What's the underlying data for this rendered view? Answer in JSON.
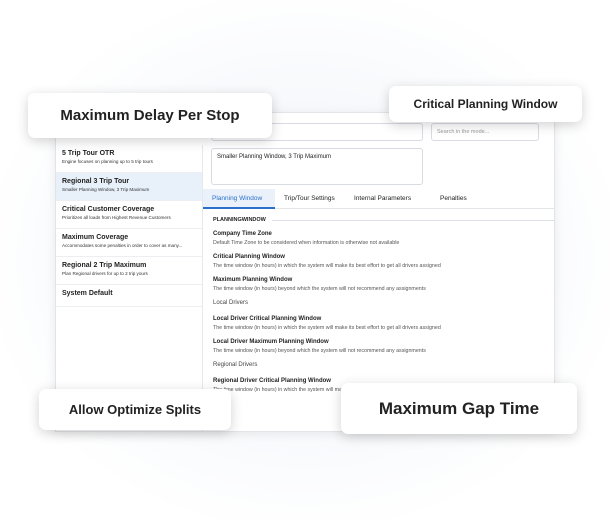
{
  "form": {
    "name_value": "Regional 3 Trip Tour",
    "search_placeholder": "Search in the mode...",
    "description_value": "Smaller Planning Window, 3 Trip Maximum"
  },
  "models": [
    {
      "title": "5 Trip Tour OTR",
      "subtitle": "Engine focuses on planning up to 5 trip tours"
    },
    {
      "title": "Regional 3 Trip Tour",
      "subtitle": "Smaller Planning Window, 3 Trip Maximum"
    },
    {
      "title": "Critical Customer Coverage",
      "subtitle": "Prioritizes all loads from Highest Revenue Customers"
    },
    {
      "title": "Maximum Coverage",
      "subtitle": "Accommodates some penalties in order to cover as many..."
    },
    {
      "title": "Regional 2 Trip Maximum",
      "subtitle": "Plan Regional drivers for up to 2 trip yours"
    },
    {
      "title": "System Default",
      "subtitle": ""
    }
  ],
  "tabs": [
    "Planning Window",
    "Trip/Tour Settings",
    "Internal Parameters",
    "Penalties"
  ],
  "content": {
    "section": "PLANNINGWINDOW",
    "fields": [
      {
        "title": "Company Time Zone",
        "desc": "Default Time Zone to be considered when information is otherwise not available"
      },
      {
        "title": "Critical Planning Window",
        "desc": "The time window (in hours) in which the system will make its best effort to get all drivers assigned"
      },
      {
        "title": "Maximum Planning Window",
        "desc": "The time window (in hours) beyond which the system will not recommend any assignments"
      }
    ],
    "group1": "Local Drivers",
    "local_fields": [
      {
        "title": "Local Driver Critical Planning Window",
        "desc": "The time window (in hours) in which the system will make its best effort to get all drivers assigned"
      },
      {
        "title": "Local Driver Maximum Planning Window",
        "desc": "The time window (in hours) beyond which the system will not recommend any assignments"
      }
    ],
    "group2": "Regional Drivers",
    "regional_fields": [
      {
        "title": "Regional Driver Critical Planning Window",
        "desc": "The time window (in hours) in which the system will make its best effort to get all drivers assigned"
      }
    ]
  },
  "callouts": {
    "delay": "Maximum Delay Per Stop",
    "critical": "Critical Planning Window",
    "splits": "Allow Optimize Splits",
    "gap": "Maximum Gap Time"
  }
}
